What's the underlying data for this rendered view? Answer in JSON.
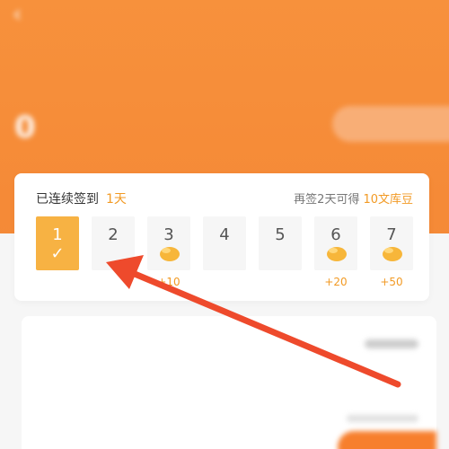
{
  "header": {
    "back_icon": "chevron-left-icon",
    "title": ""
  },
  "points": {
    "label": "",
    "value": "0"
  },
  "checkin": {
    "streak_label": "已连续签到",
    "streak_days": "1天",
    "hint_prefix": "再签2天可得",
    "hint_reward": "10文库豆",
    "days": [
      {
        "num": "1",
        "active": true,
        "bonus": ""
      },
      {
        "num": "2",
        "active": false,
        "bonus": ""
      },
      {
        "num": "3",
        "active": false,
        "bonus": "+10",
        "bean": true
      },
      {
        "num": "4",
        "active": false,
        "bonus": ""
      },
      {
        "num": "5",
        "active": false,
        "bonus": ""
      },
      {
        "num": "6",
        "active": false,
        "bonus": "+20",
        "bean": true
      },
      {
        "num": "7",
        "active": false,
        "bonus": "+50",
        "bean": true
      }
    ]
  },
  "colors": {
    "brand": "#f58a37",
    "accent": "#f29a24",
    "arrow": "#ee4a2c"
  }
}
